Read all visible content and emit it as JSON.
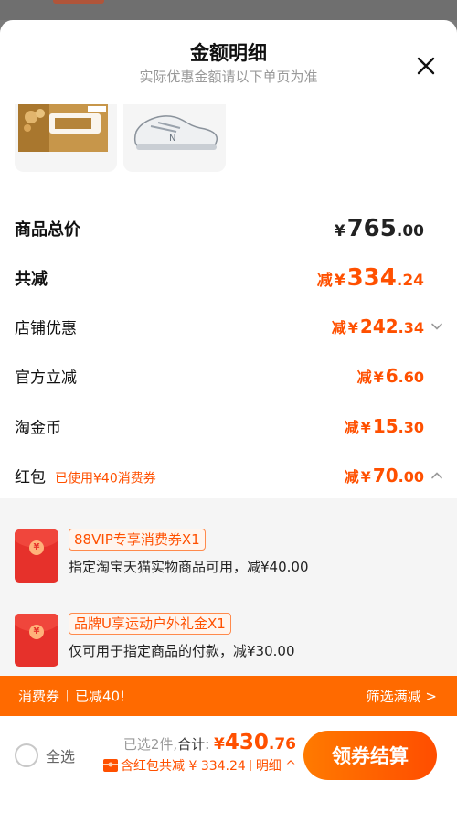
{
  "sheet": {
    "title": "金额明细",
    "subtitle": "实际优惠金额请以下单页为准"
  },
  "summary_rows": {
    "total": {
      "label": "商品总价",
      "currency": "¥",
      "int": "765",
      "dec": ".00"
    },
    "reduced": {
      "label": "共减",
      "prefix": "减",
      "currency": "¥",
      "int": "334",
      "dec": ".24"
    },
    "shop": {
      "label": "店铺优惠",
      "prefix": "减",
      "currency": "¥",
      "int": "242",
      "dec": ".34"
    },
    "official": {
      "label": "官方立减",
      "prefix": "减",
      "currency": "¥",
      "int": "6",
      "dec": ".60"
    },
    "coins": {
      "label": "淘金币",
      "prefix": "减",
      "currency": "¥",
      "int": "15",
      "dec": ".30"
    },
    "hongbao": {
      "label": "红包",
      "used": "已使用¥40消费券",
      "prefix": "减",
      "currency": "¥",
      "int": "70",
      "dec": ".00"
    }
  },
  "coupons": [
    {
      "tag": "88VIP专享消费券X1",
      "desc": "指定淘宝天猫实物商品可用，减¥40.00"
    },
    {
      "tag": "品牌U享运动户外礼金X1",
      "desc": "仅可用于指定商品的付款，减¥30.00"
    }
  ],
  "promo_bar": {
    "left_a": "消费券",
    "left_b": "已减40!",
    "right": "筛选满减 >"
  },
  "footer": {
    "select_all": "全选",
    "selected_count": "已选2件,",
    "total_label": "合计:",
    "total_currency": "¥",
    "total_int": "430",
    "total_dec": ".76",
    "discount_note": "含红包共减 ¥ 334.24",
    "detail_link": "明细 ^",
    "checkout": "领券结算"
  },
  "colors": {
    "accent": "#ff5000",
    "promo_bar": "#ff6a00",
    "coupon_red": "#e6312b"
  }
}
